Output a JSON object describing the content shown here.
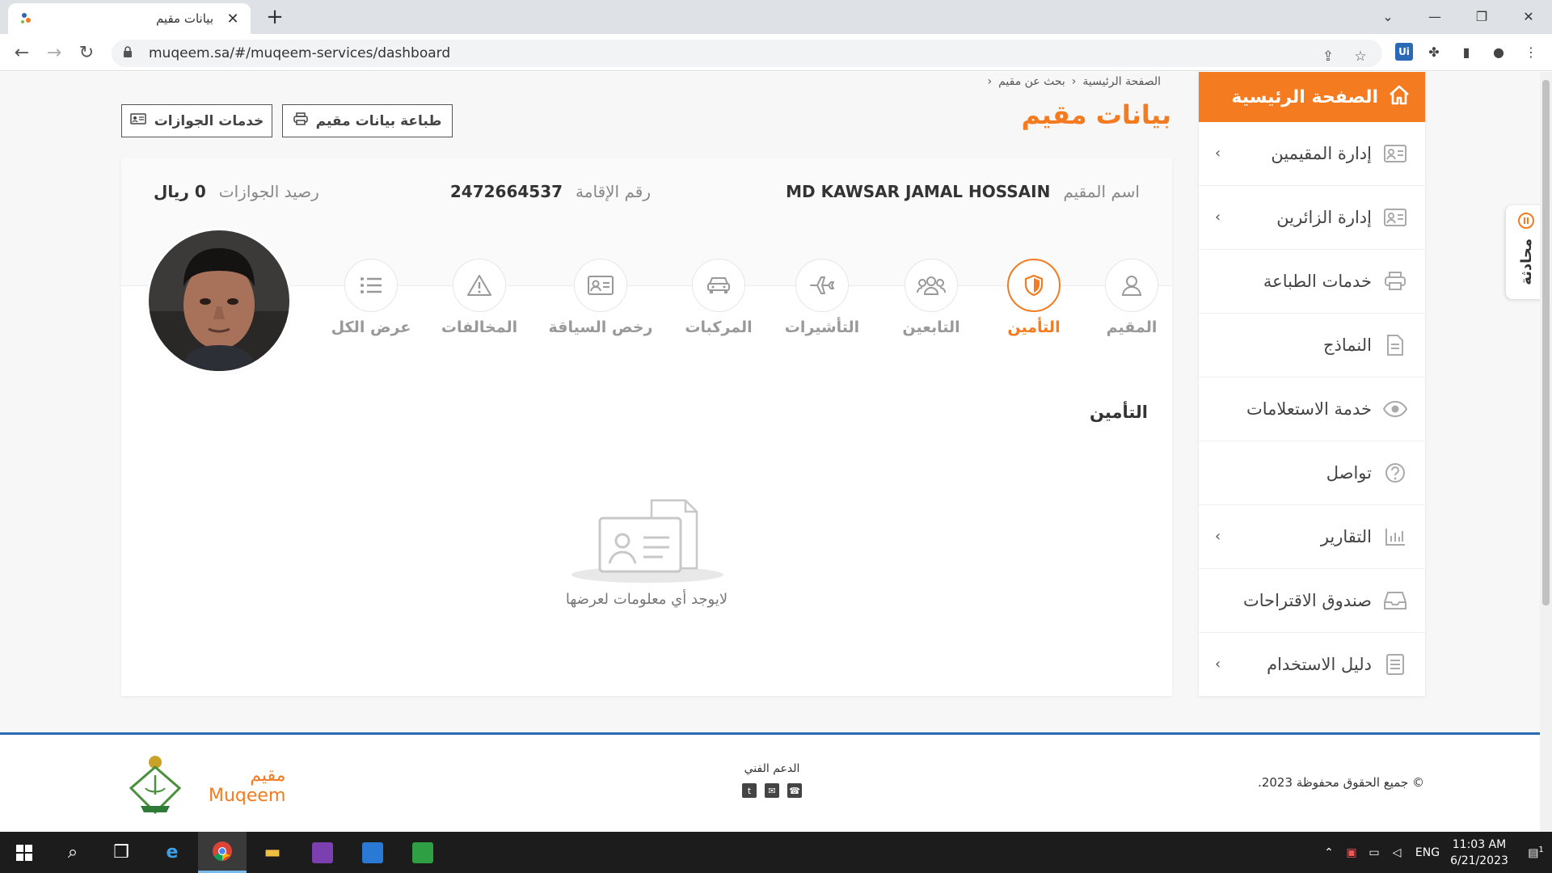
{
  "browser": {
    "tab_title": "بيانات مقيم",
    "url": "muqeem.sa/#/muqeem-services/dashboard",
    "new_tab": "+",
    "close": "✕"
  },
  "breadcrumb": [
    "الصفحة الرئيسية",
    "بحث عن مقيم"
  ],
  "page_title": "بيانات مقيم",
  "buttons": {
    "print_resident": "طباعة بيانات مقيم",
    "passport_services": "خدمات الجوازات"
  },
  "resident": {
    "name_label": "اسم المقيم",
    "name_value": "MD KAWSAR JAMAL HOSSAIN",
    "iqama_label": "رقم الإقامة",
    "iqama_value": "2472664537",
    "balance_label": "رصيد الجوازات",
    "balance_value": "0 ريال"
  },
  "tabs": [
    {
      "label": "المقيم",
      "icon": "user-icon"
    },
    {
      "label": "التأمين",
      "icon": "shield-icon",
      "active": true
    },
    {
      "label": "التابعين",
      "icon": "users-icon"
    },
    {
      "label": "التأشيرات",
      "icon": "plane-icon"
    },
    {
      "label": "المركبات",
      "icon": "car-icon"
    },
    {
      "label": "رخص السياقة",
      "icon": "id-card-icon"
    },
    {
      "label": "المخالفات",
      "icon": "warning-icon"
    },
    {
      "label": "عرض الكل",
      "icon": "list-icon"
    }
  ],
  "section_title": "التأمين",
  "empty_message": "لايوجد أي معلومات لعرضها",
  "sidebar": {
    "home": "الصفحة الرئيسية",
    "items": [
      {
        "label": "إدارة المقيمين",
        "icon": "id-card-icon",
        "has_submenu": true
      },
      {
        "label": "إدارة الزائرين",
        "icon": "id-card-icon",
        "has_submenu": true
      },
      {
        "label": "خدمات الطباعة",
        "icon": "printer-icon",
        "has_submenu": false
      },
      {
        "label": "النماذج",
        "icon": "document-icon",
        "has_submenu": false
      },
      {
        "label": "خدمة الاستعلامات",
        "icon": "eye-icon",
        "has_submenu": false
      },
      {
        "label": "تواصل",
        "icon": "help-icon",
        "has_submenu": false
      },
      {
        "label": "التقارير",
        "icon": "chart-icon",
        "has_submenu": true
      },
      {
        "label": "صندوق الاقتراحات",
        "icon": "inbox-icon",
        "has_submenu": false
      },
      {
        "label": "دليل الاستخدام",
        "icon": "book-icon",
        "has_submenu": true
      }
    ]
  },
  "chat": {
    "label": "محادثة"
  },
  "footer": {
    "copyright": "© جميع الحقوق محفوظة 2023.",
    "support_title": "الدعم الفني",
    "brand_ar": "مقيم",
    "brand_en": "Muqeem"
  },
  "taskbar": {
    "lang": "ENG",
    "time": "11:03 AM",
    "date": "6/21/2023",
    "notifications": "1"
  },
  "colors": {
    "accent": "#f47b20",
    "footer_border": "#2a6ab5"
  }
}
